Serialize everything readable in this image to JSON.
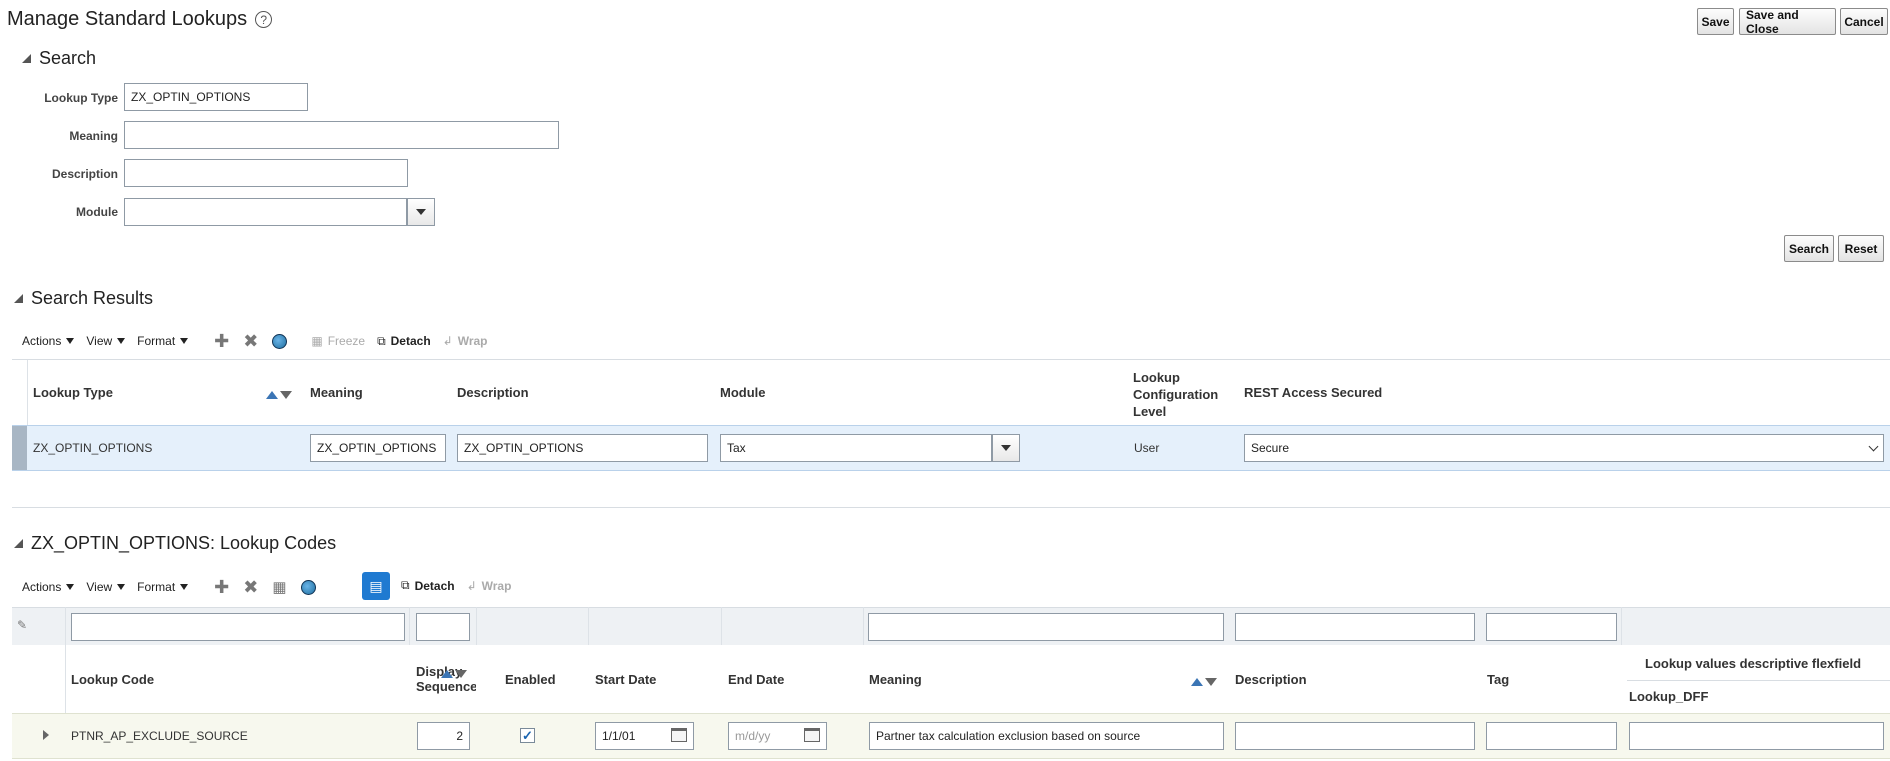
{
  "page": {
    "title": "Manage Standard Lookups",
    "help_icon": "?",
    "buttons": {
      "save": "Save",
      "save_close": "Save and Close",
      "cancel": "Cancel"
    }
  },
  "search": {
    "heading": "Search",
    "fields": {
      "lookup_type": {
        "label": "Lookup Type",
        "value": "ZX_OPTIN_OPTIONS"
      },
      "meaning": {
        "label": "Meaning",
        "value": ""
      },
      "description": {
        "label": "Description",
        "value": ""
      },
      "module": {
        "label": "Module",
        "value": ""
      }
    },
    "buttons": {
      "search": "Search",
      "reset": "Reset"
    }
  },
  "results": {
    "heading": "Search Results",
    "toolbar": {
      "actions": "Actions",
      "view": "View",
      "format": "Format",
      "freeze": "Freeze",
      "detach": "Detach",
      "wrap": "Wrap"
    },
    "columns": {
      "lookup_type": "Lookup Type",
      "meaning": "Meaning",
      "description": "Description",
      "module": "Module",
      "config_level_1": "Lookup",
      "config_level_2": "Configuration",
      "config_level_3": "Level",
      "rest": "REST Access Secured"
    },
    "row": {
      "lookup_type": "ZX_OPTIN_OPTIONS",
      "meaning": "ZX_OPTIN_OPTIONS",
      "description": "ZX_OPTIN_OPTIONS",
      "module": "Tax",
      "config_level": "User",
      "rest": "Secure"
    }
  },
  "codes": {
    "heading": "ZX_OPTIN_OPTIONS: Lookup Codes",
    "toolbar": {
      "actions": "Actions",
      "view": "View",
      "format": "Format",
      "detach": "Detach",
      "wrap": "Wrap"
    },
    "columns": {
      "lookup_code": "Lookup Code",
      "display_seq_1": "Display",
      "display_seq_2": "Sequence",
      "enabled": "Enabled",
      "start_date": "Start Date",
      "end_date": "End Date",
      "meaning": "Meaning",
      "description": "Description",
      "tag": "Tag",
      "dff_group": "Lookup values descriptive flexfield",
      "dff": "Lookup_DFF"
    },
    "row": {
      "lookup_code": "PTNR_AP_EXCLUDE_SOURCE",
      "display_seq": "2",
      "enabled": true,
      "start_date": "1/1/01",
      "end_date_placeholder": "m/d/yy",
      "meaning": "Partner tax calculation exclusion based on source",
      "description": "",
      "tag": "",
      "dff": ""
    }
  },
  "colors": {
    "accent": "#1f7ad1",
    "selected_row": "#e5f0fb",
    "code_row": "#f7f8ee"
  }
}
